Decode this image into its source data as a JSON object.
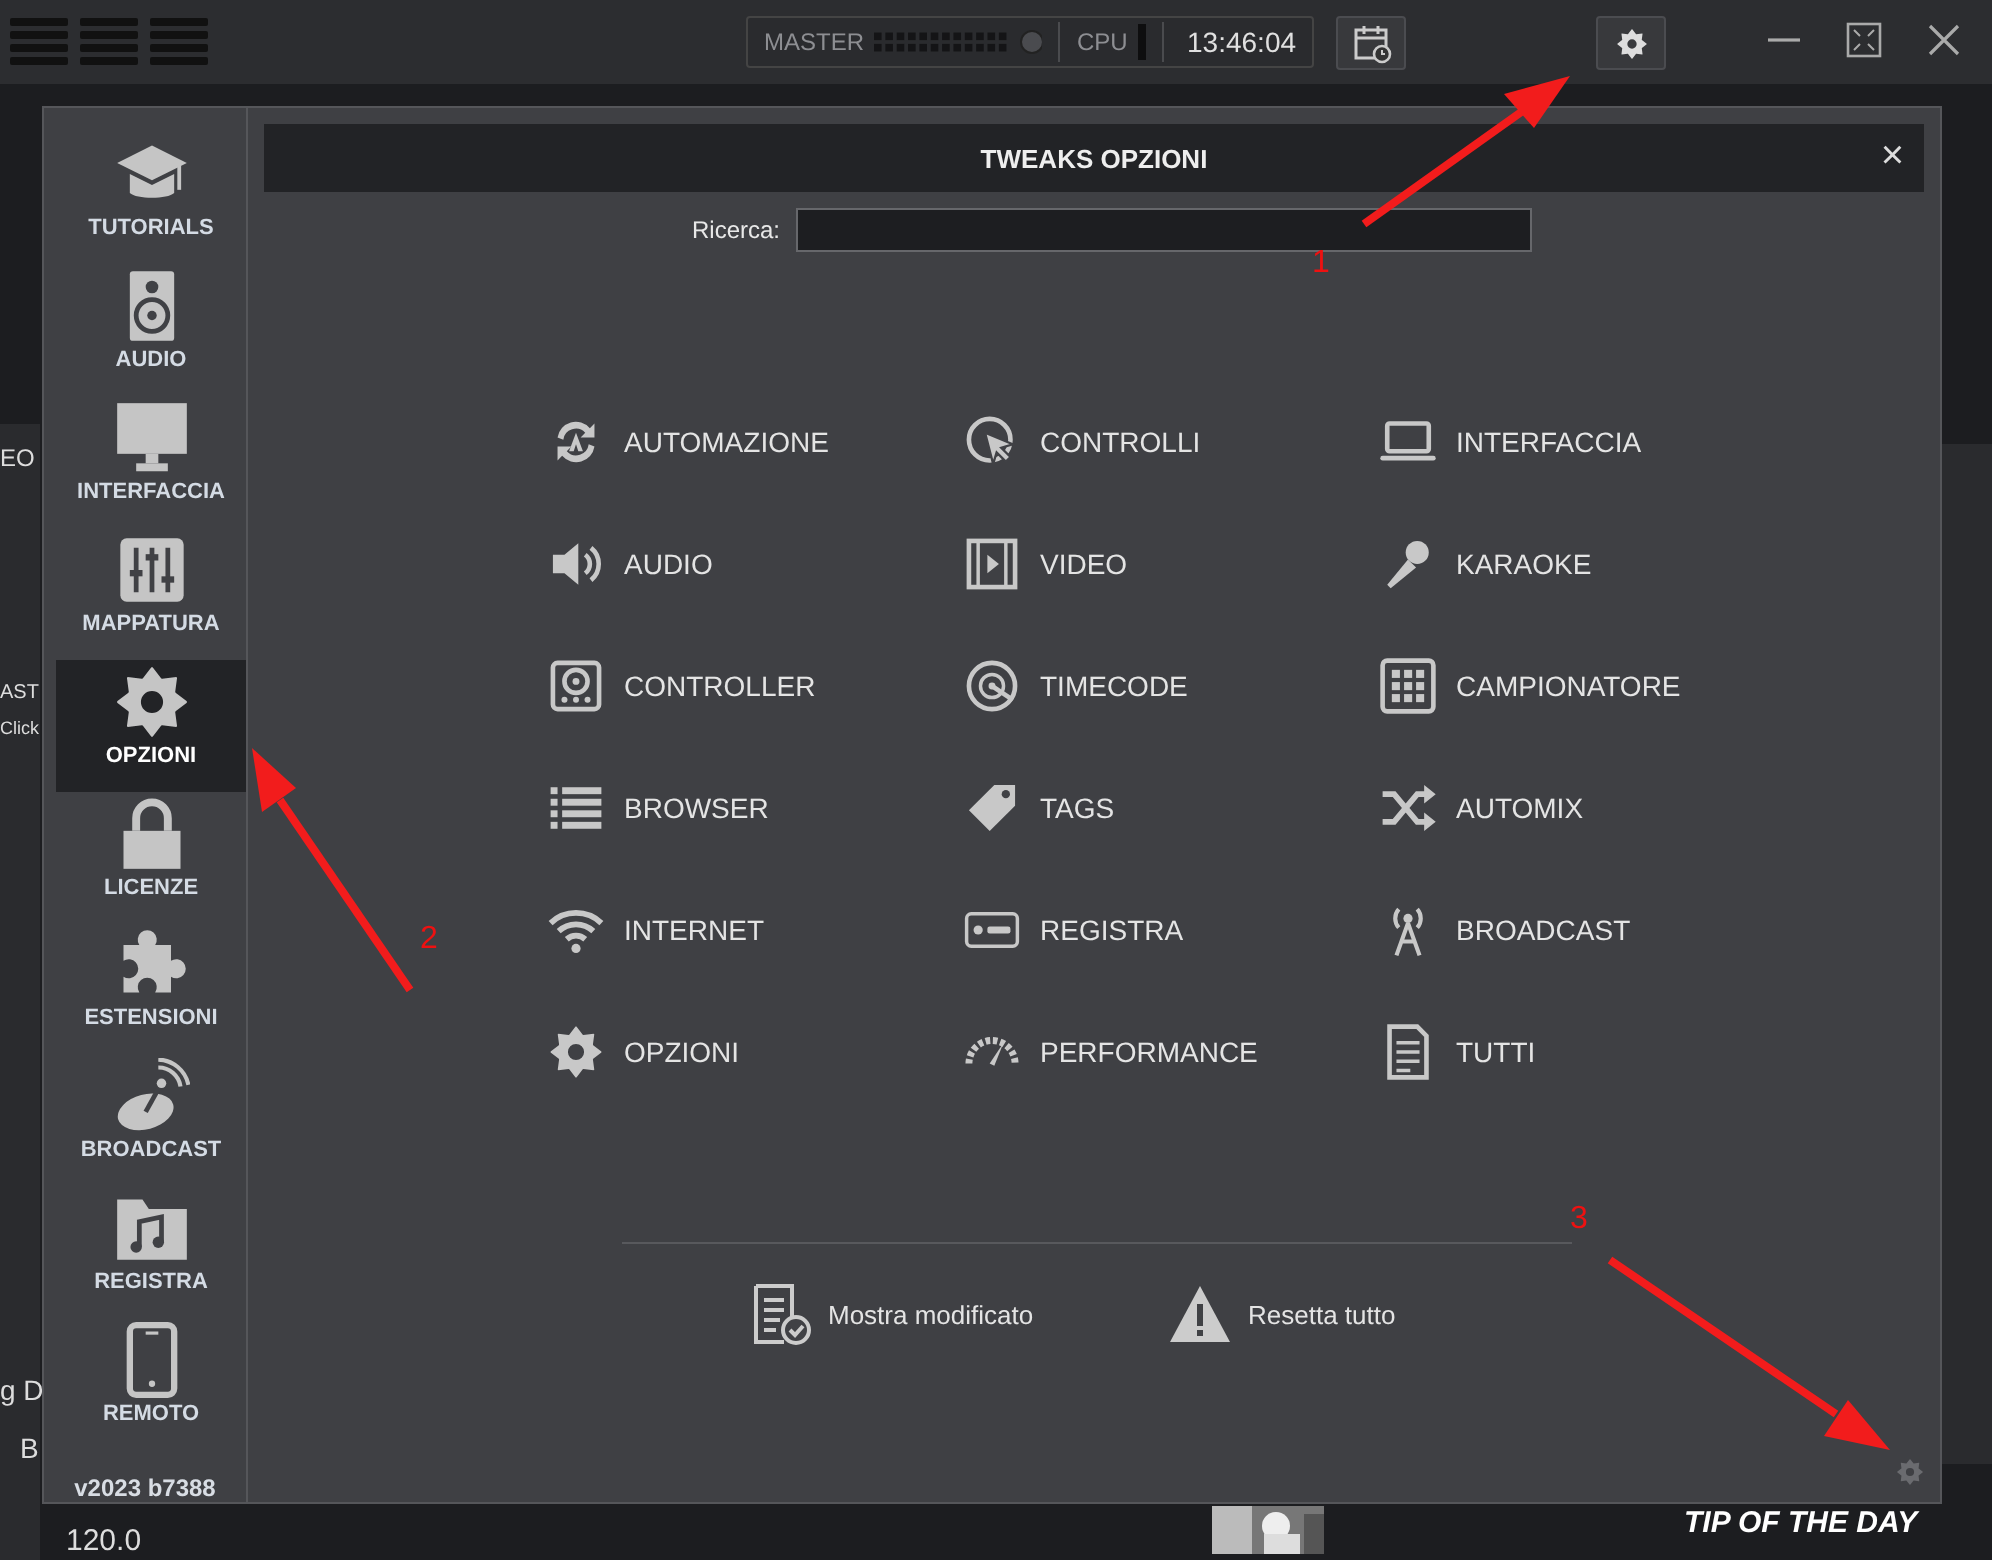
{
  "topbar": {
    "master_label": "MASTER",
    "cpu_label": "CPU",
    "clock": "13:46:04"
  },
  "background": {
    "left_texts": [
      "EO",
      "AST",
      "Click",
      "g D",
      "B",
      "120.0"
    ],
    "tip_banner": "TIP OF THE DAY"
  },
  "sidebar": {
    "items": [
      {
        "label": "TUTORIALS",
        "selected": false
      },
      {
        "label": "AUDIO",
        "selected": false
      },
      {
        "label": "INTERFACCIA",
        "selected": false
      },
      {
        "label": "MAPPATURA",
        "selected": false
      },
      {
        "label": "OPZIONI",
        "selected": true
      },
      {
        "label": "LICENZE",
        "selected": false
      },
      {
        "label": "ESTENSIONI",
        "selected": false
      },
      {
        "label": "BROADCAST",
        "selected": false
      },
      {
        "label": "REGISTRA",
        "selected": false
      },
      {
        "label": "REMOTO",
        "selected": false
      }
    ],
    "version": "v2023 b7388"
  },
  "dialog": {
    "title": "TWEAKS OPZIONI",
    "close": "×",
    "search": {
      "label": "Ricerca:"
    },
    "categories": [
      "AUTOMAZIONE",
      "CONTROLLI",
      "INTERFACCIA",
      "AUDIO",
      "VIDEO",
      "KARAOKE",
      "CONTROLLER",
      "TIMECODE",
      "CAMPIONATORE",
      "BROWSER",
      "TAGS",
      "AUTOMIX",
      "INTERNET",
      "REGISTRA",
      "BROADCAST",
      "OPZIONI",
      "PERFORMANCE",
      "TUTTI"
    ],
    "actions": [
      {
        "label": "Mostra modificato"
      },
      {
        "label": "Resetta tutto"
      }
    ]
  },
  "annotations": [
    {
      "number": "1"
    },
    {
      "number": "2"
    },
    {
      "number": "3"
    }
  ]
}
